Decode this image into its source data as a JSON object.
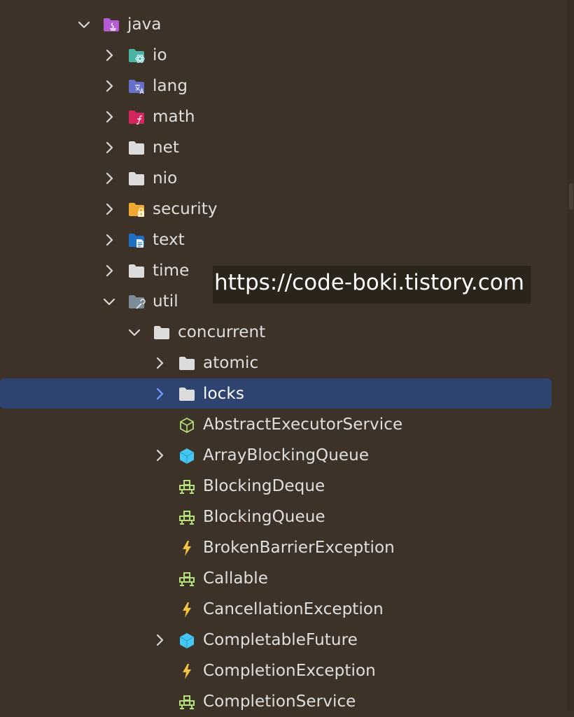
{
  "watermark": "https://code-boki.tistory.com",
  "colors": {
    "background": "#3d3227",
    "selection": "#2f4371",
    "folder_default": "#dcdcdc",
    "java_folder": "#b45ad2",
    "io_folder": "#4bb3a3",
    "lang_folder": "#6670c8",
    "math_folder": "#d4265e",
    "security_folder": "#f0a830",
    "text_folder": "#1f6fc4",
    "util_folder": "#7d8b99",
    "class_icon": "#45c7f4",
    "interface_icon": "#b3e07a",
    "exception_icon": "#f5c242"
  },
  "tree": [
    {
      "label": "java",
      "depth": 0,
      "expanded": true,
      "has_chevron": true,
      "icon": "java-folder-icon"
    },
    {
      "label": "io",
      "depth": 1,
      "expanded": false,
      "has_chevron": true,
      "icon": "io-folder-icon"
    },
    {
      "label": "lang",
      "depth": 1,
      "expanded": false,
      "has_chevron": true,
      "icon": "lang-folder-icon"
    },
    {
      "label": "math",
      "depth": 1,
      "expanded": false,
      "has_chevron": true,
      "icon": "math-folder-icon"
    },
    {
      "label": "net",
      "depth": 1,
      "expanded": false,
      "has_chevron": true,
      "icon": "folder-icon"
    },
    {
      "label": "nio",
      "depth": 1,
      "expanded": false,
      "has_chevron": true,
      "icon": "folder-icon"
    },
    {
      "label": "security",
      "depth": 1,
      "expanded": false,
      "has_chevron": true,
      "icon": "security-folder-icon"
    },
    {
      "label": "text",
      "depth": 1,
      "expanded": false,
      "has_chevron": true,
      "icon": "text-folder-icon"
    },
    {
      "label": "time",
      "depth": 1,
      "expanded": false,
      "has_chevron": true,
      "icon": "folder-icon"
    },
    {
      "label": "util",
      "depth": 1,
      "expanded": true,
      "has_chevron": true,
      "icon": "util-folder-icon"
    },
    {
      "label": "concurrent",
      "depth": 2,
      "expanded": true,
      "has_chevron": true,
      "icon": "folder-icon"
    },
    {
      "label": "atomic",
      "depth": 3,
      "expanded": false,
      "has_chevron": true,
      "icon": "folder-icon"
    },
    {
      "label": "locks",
      "depth": 3,
      "expanded": false,
      "has_chevron": true,
      "icon": "folder-icon",
      "selected": true
    },
    {
      "label": "AbstractExecutorService",
      "depth": 3,
      "has_chevron": false,
      "icon": "abstract-class-icon"
    },
    {
      "label": "ArrayBlockingQueue",
      "depth": 3,
      "expanded": false,
      "has_chevron": true,
      "icon": "class-icon"
    },
    {
      "label": "BlockingDeque",
      "depth": 3,
      "has_chevron": false,
      "icon": "interface-icon"
    },
    {
      "label": "BlockingQueue",
      "depth": 3,
      "has_chevron": false,
      "icon": "interface-icon"
    },
    {
      "label": "BrokenBarrierException",
      "depth": 3,
      "has_chevron": false,
      "icon": "exception-icon"
    },
    {
      "label": "Callable",
      "depth": 3,
      "has_chevron": false,
      "icon": "interface-icon"
    },
    {
      "label": "CancellationException",
      "depth": 3,
      "has_chevron": false,
      "icon": "exception-icon"
    },
    {
      "label": "CompletableFuture",
      "depth": 3,
      "expanded": false,
      "has_chevron": true,
      "icon": "class-icon"
    },
    {
      "label": "CompletionException",
      "depth": 3,
      "has_chevron": false,
      "icon": "exception-icon"
    },
    {
      "label": "CompletionService",
      "depth": 3,
      "has_chevron": false,
      "icon": "interface-icon"
    }
  ]
}
